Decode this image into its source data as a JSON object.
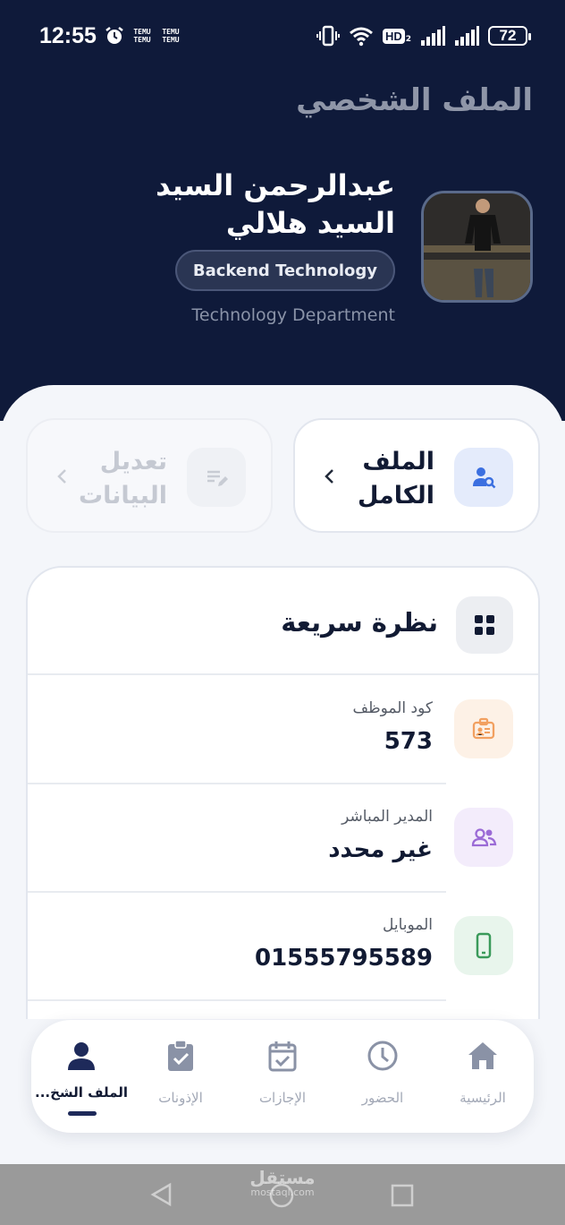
{
  "status_bar": {
    "time": "12:55",
    "temu_label_1": "TEMU TEMU",
    "temu_label_2": "TEMU TEMU",
    "hd_label": "HD",
    "hd_sub": "2",
    "battery": "72"
  },
  "header": {
    "page_title": "الملف الشخصي",
    "name": "عبدالرحمن السيد السيد هلالي",
    "role": "Backend Technology",
    "department": "Technology Department"
  },
  "actions": {
    "full_profile": "الملف الكامل",
    "edit_data": "تعديل البيانات"
  },
  "overview": {
    "title": "نظرة سريعة",
    "rows": [
      {
        "label": "كود الموظف",
        "value": "573",
        "icon": "id-badge-icon",
        "color": "#f2a060"
      },
      {
        "label": "المدير المباشر",
        "value": "غير محدد",
        "icon": "users-icon",
        "color": "#9b6bd6"
      },
      {
        "label": "الموبايل",
        "value": "01555795589",
        "icon": "mobile-icon",
        "color": "#3a9a5a"
      }
    ]
  },
  "bottom_nav": {
    "items": [
      {
        "label": "الملف الشخ...",
        "icon": "person-icon",
        "active": true
      },
      {
        "label": "الإذونات",
        "icon": "clipboard-check-icon"
      },
      {
        "label": "الإجازات",
        "icon": "calendar-check-icon"
      },
      {
        "label": "الحضور",
        "icon": "clock-icon"
      },
      {
        "label": "الرئيسية",
        "icon": "home-icon"
      }
    ]
  },
  "watermark": {
    "text": "مستقل",
    "sub": "mostaql.com"
  },
  "colors": {
    "header_bg": "#0f1a3a",
    "accent": "#1e2a5a",
    "page_bg": "#f4f6fa"
  }
}
